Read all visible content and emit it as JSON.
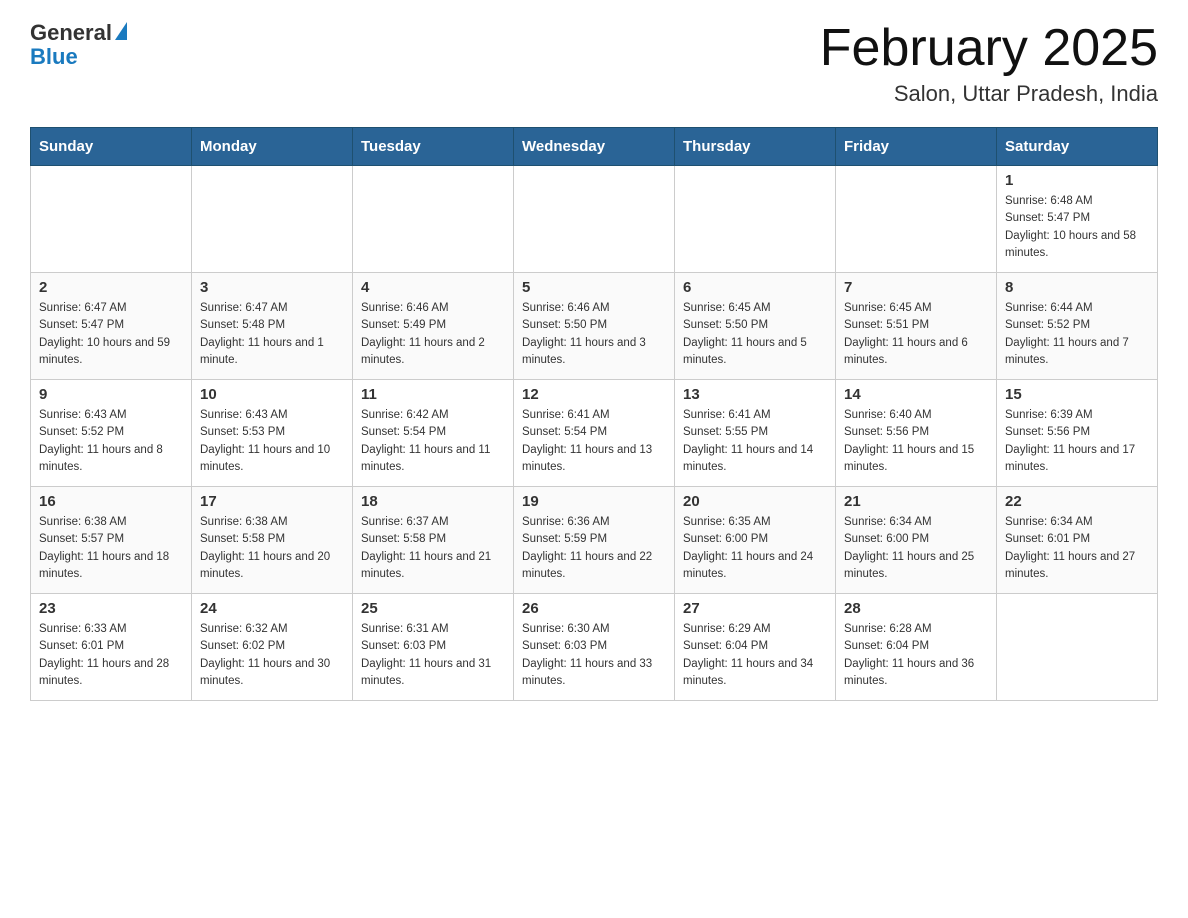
{
  "header": {
    "logo": {
      "general": "General",
      "blue": "Blue"
    },
    "title": "February 2025",
    "location": "Salon, Uttar Pradesh, India"
  },
  "days_of_week": [
    "Sunday",
    "Monday",
    "Tuesday",
    "Wednesday",
    "Thursday",
    "Friday",
    "Saturday"
  ],
  "weeks": [
    [
      {
        "day": "",
        "info": ""
      },
      {
        "day": "",
        "info": ""
      },
      {
        "day": "",
        "info": ""
      },
      {
        "day": "",
        "info": ""
      },
      {
        "day": "",
        "info": ""
      },
      {
        "day": "",
        "info": ""
      },
      {
        "day": "1",
        "info": "Sunrise: 6:48 AM\nSunset: 5:47 PM\nDaylight: 10 hours and 58 minutes."
      }
    ],
    [
      {
        "day": "2",
        "info": "Sunrise: 6:47 AM\nSunset: 5:47 PM\nDaylight: 10 hours and 59 minutes."
      },
      {
        "day": "3",
        "info": "Sunrise: 6:47 AM\nSunset: 5:48 PM\nDaylight: 11 hours and 1 minute."
      },
      {
        "day": "4",
        "info": "Sunrise: 6:46 AM\nSunset: 5:49 PM\nDaylight: 11 hours and 2 minutes."
      },
      {
        "day": "5",
        "info": "Sunrise: 6:46 AM\nSunset: 5:50 PM\nDaylight: 11 hours and 3 minutes."
      },
      {
        "day": "6",
        "info": "Sunrise: 6:45 AM\nSunset: 5:50 PM\nDaylight: 11 hours and 5 minutes."
      },
      {
        "day": "7",
        "info": "Sunrise: 6:45 AM\nSunset: 5:51 PM\nDaylight: 11 hours and 6 minutes."
      },
      {
        "day": "8",
        "info": "Sunrise: 6:44 AM\nSunset: 5:52 PM\nDaylight: 11 hours and 7 minutes."
      }
    ],
    [
      {
        "day": "9",
        "info": "Sunrise: 6:43 AM\nSunset: 5:52 PM\nDaylight: 11 hours and 8 minutes."
      },
      {
        "day": "10",
        "info": "Sunrise: 6:43 AM\nSunset: 5:53 PM\nDaylight: 11 hours and 10 minutes."
      },
      {
        "day": "11",
        "info": "Sunrise: 6:42 AM\nSunset: 5:54 PM\nDaylight: 11 hours and 11 minutes."
      },
      {
        "day": "12",
        "info": "Sunrise: 6:41 AM\nSunset: 5:54 PM\nDaylight: 11 hours and 13 minutes."
      },
      {
        "day": "13",
        "info": "Sunrise: 6:41 AM\nSunset: 5:55 PM\nDaylight: 11 hours and 14 minutes."
      },
      {
        "day": "14",
        "info": "Sunrise: 6:40 AM\nSunset: 5:56 PM\nDaylight: 11 hours and 15 minutes."
      },
      {
        "day": "15",
        "info": "Sunrise: 6:39 AM\nSunset: 5:56 PM\nDaylight: 11 hours and 17 minutes."
      }
    ],
    [
      {
        "day": "16",
        "info": "Sunrise: 6:38 AM\nSunset: 5:57 PM\nDaylight: 11 hours and 18 minutes."
      },
      {
        "day": "17",
        "info": "Sunrise: 6:38 AM\nSunset: 5:58 PM\nDaylight: 11 hours and 20 minutes."
      },
      {
        "day": "18",
        "info": "Sunrise: 6:37 AM\nSunset: 5:58 PM\nDaylight: 11 hours and 21 minutes."
      },
      {
        "day": "19",
        "info": "Sunrise: 6:36 AM\nSunset: 5:59 PM\nDaylight: 11 hours and 22 minutes."
      },
      {
        "day": "20",
        "info": "Sunrise: 6:35 AM\nSunset: 6:00 PM\nDaylight: 11 hours and 24 minutes."
      },
      {
        "day": "21",
        "info": "Sunrise: 6:34 AM\nSunset: 6:00 PM\nDaylight: 11 hours and 25 minutes."
      },
      {
        "day": "22",
        "info": "Sunrise: 6:34 AM\nSunset: 6:01 PM\nDaylight: 11 hours and 27 minutes."
      }
    ],
    [
      {
        "day": "23",
        "info": "Sunrise: 6:33 AM\nSunset: 6:01 PM\nDaylight: 11 hours and 28 minutes."
      },
      {
        "day": "24",
        "info": "Sunrise: 6:32 AM\nSunset: 6:02 PM\nDaylight: 11 hours and 30 minutes."
      },
      {
        "day": "25",
        "info": "Sunrise: 6:31 AM\nSunset: 6:03 PM\nDaylight: 11 hours and 31 minutes."
      },
      {
        "day": "26",
        "info": "Sunrise: 6:30 AM\nSunset: 6:03 PM\nDaylight: 11 hours and 33 minutes."
      },
      {
        "day": "27",
        "info": "Sunrise: 6:29 AM\nSunset: 6:04 PM\nDaylight: 11 hours and 34 minutes."
      },
      {
        "day": "28",
        "info": "Sunrise: 6:28 AM\nSunset: 6:04 PM\nDaylight: 11 hours and 36 minutes."
      },
      {
        "day": "",
        "info": ""
      }
    ]
  ]
}
